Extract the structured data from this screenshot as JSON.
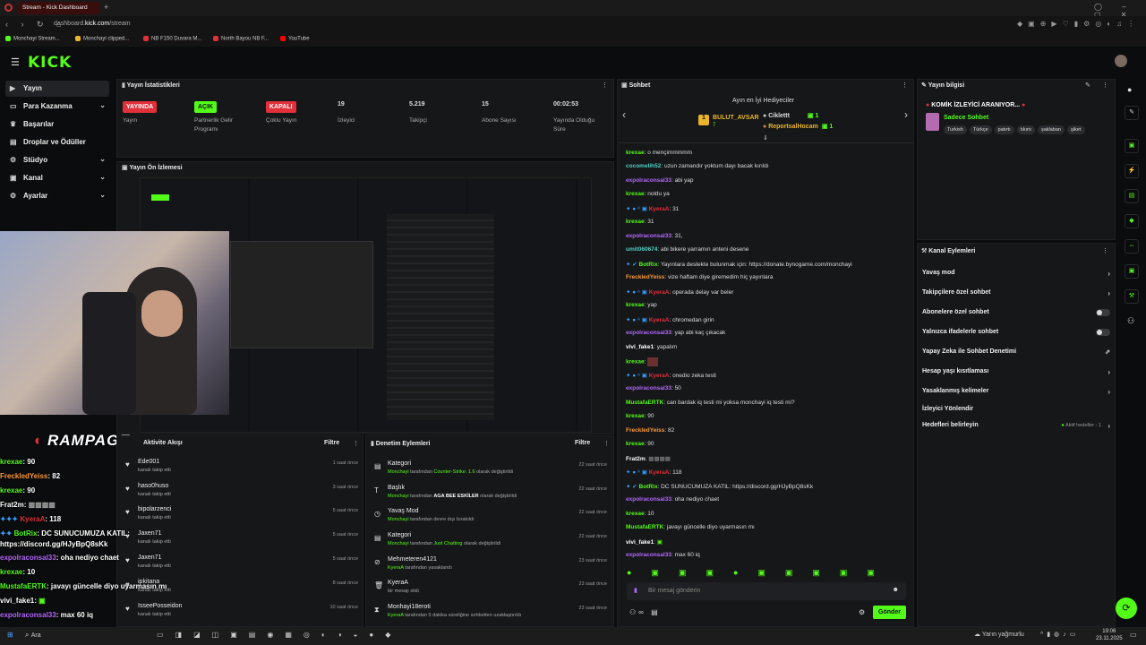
{
  "browser": {
    "tab_title": "Stream - Kick Dashboard",
    "url_prefix": "dashboard.",
    "url_host": "kick.com",
    "url_path": "/stream",
    "bookmarks": [
      "Monchayi Stream...",
      "Monchayi clipped...",
      "NB F150 Duvara M...",
      "North Bayou NB F...",
      "YouTube"
    ]
  },
  "header": {
    "logo": "KICK"
  },
  "sidebar": {
    "items": [
      {
        "label": "Yayın",
        "icon": "video-icon",
        "active": true
      },
      {
        "label": "Para Kazanma",
        "icon": "money-icon",
        "chevron": true
      },
      {
        "label": "Başarılar",
        "icon": "trophy-icon"
      },
      {
        "label": "Droplar ve Ödüller",
        "icon": "gift-icon"
      },
      {
        "label": "Stüdyo",
        "icon": "studio-icon",
        "chevron": true
      },
      {
        "label": "Kanal",
        "icon": "channel-icon",
        "chevron": true
      },
      {
        "label": "Ayarlar",
        "icon": "gear-icon",
        "chevron": true
      }
    ]
  },
  "stats": {
    "title": "Yayın İstatistikleri",
    "items": [
      {
        "value": "YAYINDA",
        "label": "Yayın",
        "kind": "badge-red"
      },
      {
        "value": "AÇIK",
        "label": "Partnerlik Gelir Programı",
        "kind": "badge-green"
      },
      {
        "value": "KAPALI",
        "label": "Çoklu Yayın",
        "kind": "badge-red"
      },
      {
        "value": "19",
        "label": "İzleyici"
      },
      {
        "value": "5.219",
        "label": "Takipçi"
      },
      {
        "value": "15",
        "label": "Abone Sayısı"
      },
      {
        "value": "00:02:53",
        "label": "Yayında Olduğu Süre"
      }
    ]
  },
  "preview": {
    "title": "Yayın Ön İzlemesi"
  },
  "overlay": {
    "brand": "RAMPAGE",
    "chat": [
      {
        "user": "krexae",
        "text": ": 90",
        "color": "#53fc18"
      },
      {
        "user": "FreckledYeiss",
        "text": ": 82",
        "color": "#ff9a3c"
      },
      {
        "user": "krexae",
        "text": ": 90",
        "color": "#53fc18"
      },
      {
        "user": "Frat2m",
        "text": ":",
        "color": "#fff"
      },
      {
        "user": "KyeraA",
        "text": ": 118",
        "color": "#e0303a"
      },
      {
        "user": "BotRix",
        "text": ": DC SUNUCUMUZA KATIL:",
        "color": "#53fc18"
      },
      {
        "user": "",
        "text": "https://discord.gg/HJyBpQ8sKk",
        "color": "#fff"
      },
      {
        "user": "expolraconsal33",
        "text": ": oha nediyo chaet",
        "color": "#b368ff"
      },
      {
        "user": "krexae",
        "text": ": 10",
        "color": "#53fc18"
      },
      {
        "user": "MustafaERTK",
        "text": ": javayı güncelle diyo uyarmasın mı",
        "color": "#53fc18"
      },
      {
        "user": "vivi_fake1",
        "text": ":",
        "color": "#fff"
      },
      {
        "user": "expolraconsal33",
        "text": ": max 60 iq",
        "color": "#b368ff"
      }
    ]
  },
  "activity": {
    "title": "Aktivite Akışı",
    "filter": "Filtre",
    "rows": [
      {
        "name": "Ede001",
        "sub": "kanalı takip etti",
        "time": "1 saat önce"
      },
      {
        "name": "haso0huso",
        "sub": "kanalı takip etti",
        "time": "3 saat önce"
      },
      {
        "name": "bipolarzenci",
        "sub": "kanalı takip etti",
        "time": "5 saat önce"
      },
      {
        "name": "Jaxen71",
        "sub": "kanalı takip etti",
        "time": "5 saat önce"
      },
      {
        "name": "Jaxen71",
        "sub": "kanalı takip etti",
        "time": "5 saat önce"
      },
      {
        "name": "ipkitana",
        "sub": "kanalı takip etti",
        "time": "8 saat önce"
      },
      {
        "name": "IsseePosseidon",
        "sub": "kanalı takip etti",
        "time": "10 saat önce"
      }
    ]
  },
  "moderation": {
    "title": "Denetim Eylemleri",
    "filter": "Filtre",
    "rows": [
      {
        "icon": "category-icon",
        "name": "Kategori",
        "actor": "Monchayi",
        "mid": " tarafından ",
        "value": "Counter-Strike: 1.6",
        "end": " olarak değiştirildi",
        "time": "22 saat önce"
      },
      {
        "icon": "title-icon",
        "name": "Başlık",
        "actor": "Monchayi",
        "mid": " tarafından ",
        "value": "AGA BEE ESKİLER",
        "end": " olarak değiştirildi",
        "time": "22 saat önce"
      },
      {
        "icon": "slow-icon",
        "name": "Yavaş Mod",
        "actor": "Monchayi",
        "mid": " tarafından devre dışı bırakıldı",
        "value": "",
        "end": "",
        "time": "22 saat önce"
      },
      {
        "icon": "category-icon",
        "name": "Kategori",
        "actor": "Monchayi",
        "mid": " tarafından ",
        "value": "Just Chatting",
        "end": " olarak değiştirildi",
        "time": "22 saat önce"
      },
      {
        "icon": "ban-icon",
        "name": "Mehmeteren4121",
        "actor": "KyeraA",
        "mid": " tarafından yasaklandı",
        "value": "",
        "end": "",
        "time": "23 saat önce"
      },
      {
        "icon": "trash-icon",
        "name": "KyeraA",
        "actor": "",
        "mid": "bir mesajı sildi",
        "value": "",
        "end": "",
        "time": "23 saat önce"
      },
      {
        "icon": "timeout-icon",
        "name": "Monhayi18eroti",
        "actor": "KyeraA",
        "mid": " tarafından 5 dakika süreliğine sohbetten uzaklaştırıldı",
        "value": "",
        "end": "",
        "time": "23 saat önce"
      }
    ]
  },
  "chat": {
    "title": "Sohbet",
    "gifter_title": "Ayın en İyi Hediyeciler",
    "top1": "BULUT_AVSAR",
    "top1_count": "7",
    "top2": "Ciklettt",
    "top2_count": "1",
    "top3": "ReportsalHocam",
    "top3_count": "1",
    "messages": [
      {
        "user": "krexae",
        "text": ": o mençimmmmm",
        "color": "#53fc18"
      },
      {
        "user": "cocomelih52",
        "text": ": uzun zamandır yoktum dayı bacak kırıldı",
        "color": "#4fd1c5"
      },
      {
        "user": "expolraconsal33",
        "text": ": abi yap",
        "color": "#b368ff"
      },
      {
        "user": "krexae",
        "text": ": noldu ya",
        "color": "#53fc18"
      },
      {
        "user": "KyeraA",
        "text": ": 31",
        "color": "#e0303a",
        "badges": true
      },
      {
        "user": "krexae",
        "text": ": 31",
        "color": "#53fc18"
      },
      {
        "user": "expolraconsal33",
        "text": ": 31,",
        "color": "#b368ff"
      },
      {
        "user": "umit060674",
        "text": ": abi bikere yarramın anteni desene",
        "color": "#4fd1c5"
      },
      {
        "user": "BotRix",
        "text": ": Yayınlara destekte bulunmak için: https://donate.bynogame.com/monchayi",
        "color": "#53fc18",
        "badges": true
      },
      {
        "user": "FreckledYeiss",
        "text": ": vize haftam diye giremedim hiç yayınlara",
        "color": "#ff9a3c"
      },
      {
        "user": "KyeraA",
        "text": ": operada delay var beler",
        "color": "#e0303a",
        "badges": true
      },
      {
        "user": "krexae",
        "text": ": yap",
        "color": "#53fc18"
      },
      {
        "user": "KyeraA",
        "text": ": chromedan girin",
        "color": "#e0303a",
        "badges": true
      },
      {
        "user": "expolraconsal33",
        "text": ": yap abi kaç çıkacak",
        "color": "#b368ff"
      },
      {
        "user": "vivi_fake1",
        "text": ": yapalım",
        "color": "#ffffff"
      },
      {
        "user": "krexae",
        "text": ":",
        "color": "#53fc18"
      },
      {
        "user": "KyeraA",
        "text": ": onedio zeka testi",
        "color": "#e0303a",
        "badges": true
      },
      {
        "user": "expolraconsal33",
        "text": ": 50",
        "color": "#b368ff"
      },
      {
        "user": "MustafaERTK",
        "text": ": can bardak iq testi mi yoksa monchayi iq testi mi?",
        "color": "#53fc18"
      },
      {
        "user": "krexae",
        "text": ": 90",
        "color": "#53fc18"
      },
      {
        "user": "FreckledYeiss",
        "text": ": 82",
        "color": "#ff9a3c"
      },
      {
        "user": "krexae",
        "text": ": 90",
        "color": "#53fc18"
      },
      {
        "user": "Frat2m",
        "text": ":",
        "color": "#ffffff"
      },
      {
        "user": "KyeraA",
        "text": ": 118",
        "color": "#e0303a",
        "badges": true
      },
      {
        "user": "BotRix",
        "text": ": DC SUNUCUMUZA KATIL: https://discord.gg/HJyBpQ8sKk",
        "color": "#53fc18",
        "badges": true
      },
      {
        "user": "expolraconsal33",
        "text": ": oha nediyo chaet",
        "color": "#b368ff"
      },
      {
        "user": "krexae",
        "text": ": 10",
        "color": "#53fc18"
      },
      {
        "user": "MustafaERTK",
        "text": ": javayı güncelle diyo uyarmasın mı",
        "color": "#53fc18"
      },
      {
        "user": "vivi_fake1",
        "text": ":",
        "color": "#ffffff"
      },
      {
        "user": "expolraconsal33",
        "text": ": max 60 iq",
        "color": "#b368ff"
      }
    ],
    "input_placeholder": "Bir mesaj gönderin",
    "send": "Gönder"
  },
  "stream_info": {
    "title": "Yayın bilgisi",
    "stream_title": "KOMİK İZLEYİCİ ARANIYOR...",
    "category": "Sadece Sohbet",
    "tags": [
      "Turkish",
      "Türkçe",
      "patırtı",
      "tıkırtı",
      "şaklaban",
      "şikırt"
    ]
  },
  "channel_actions": {
    "title": "Kanal Eylemleri",
    "rows": [
      {
        "label": "Yavaş mod",
        "kind": "chevron"
      },
      {
        "label": "Takipçilere özel sohbet",
        "kind": "chevron"
      },
      {
        "label": "Abonelere özel sohbet",
        "kind": "toggle"
      },
      {
        "label": "Yalnızca ifadelerle sohbet",
        "kind": "toggle"
      },
      {
        "label": "Yapay Zeka ile Sohbet Denetimi",
        "kind": "external"
      },
      {
        "label": "Hesap yaşı kısıtlaması",
        "kind": "chevron"
      },
      {
        "label": "Yasaklanmış kelimeler",
        "kind": "chevron"
      },
      {
        "label": "İzleyici Yönlendir",
        "kind": "none"
      },
      {
        "label": "Hedefleri belirleyin",
        "kind": "chevron",
        "extra": "Aktif hedefler - 1"
      }
    ]
  },
  "taskbar": {
    "search": "Ara",
    "weather": "Yarın yağmurlu",
    "time": "19:06",
    "date": "23.11.2025"
  },
  "colors": {
    "accent": "#53fc18",
    "live": "#e0303a",
    "bg": "#0b0c0d",
    "panel": "#161719"
  }
}
